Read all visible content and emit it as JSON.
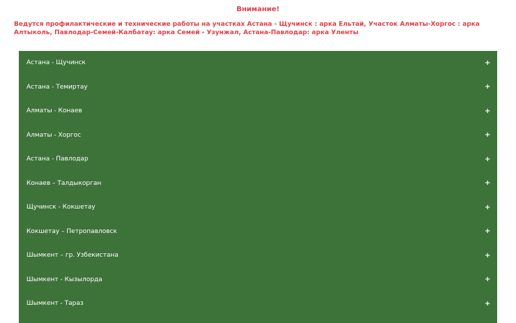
{
  "notice": {
    "title": "Внимание!",
    "text": "Ведутся профилактические и технические работы на участках Астана - Щучинск : арка Ельтай, Участок Алматы-Хоргос : арка Алтыколь, Павлодар-Семей-Калбатау: арка Семей - Узунжал, Астана-Павлодар: арка Уленты"
  },
  "accordion": {
    "toggle_symbol": "+",
    "items": [
      "Астана - Щучинск",
      "Астана - Темиртау",
      "Алматы - Конаев",
      "Алматы - Хоргос",
      "Астана - Павлодар",
      "Конаев – Талдыкорган",
      "Щучинск - Кокшетау",
      "Кокшетау – Петропавловск",
      "Шымкент – гр. Узбекистана",
      "Шымкент - Кызылорда",
      "Шымкент - Тараз"
    ]
  },
  "colors": {
    "notice_text": "#e0404a",
    "accordion_bg": "#3d7339",
    "accordion_text": "#ffffff"
  }
}
